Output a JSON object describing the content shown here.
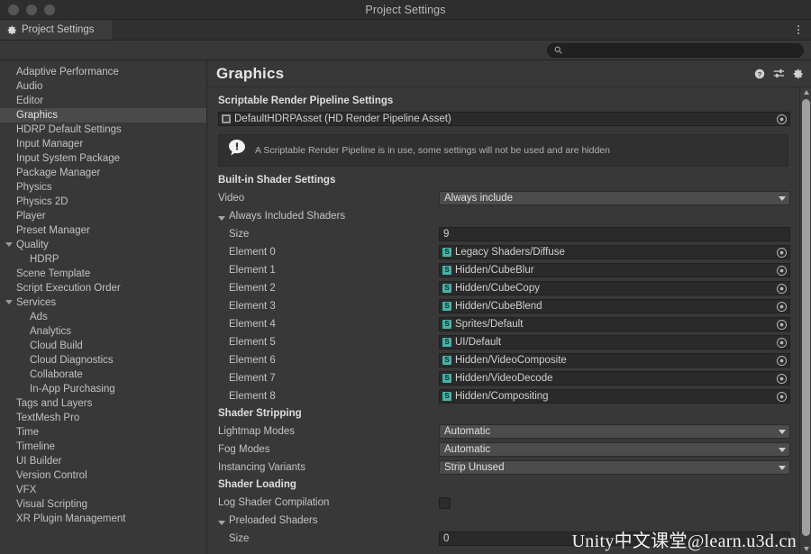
{
  "window": {
    "title": "Project Settings",
    "traffic_lights": [
      "close",
      "minimize",
      "zoom"
    ]
  },
  "tab": {
    "label": "Project Settings",
    "icon": "gear-icon",
    "menu_icon": "kebab-menu-icon"
  },
  "search": {
    "value": "",
    "placeholder": "",
    "icon": "search-icon"
  },
  "sidebar": {
    "items": [
      {
        "label": "Adaptive Performance",
        "indent": 0,
        "foldout": false,
        "selected": false
      },
      {
        "label": "Audio",
        "indent": 0,
        "foldout": false,
        "selected": false
      },
      {
        "label": "Editor",
        "indent": 0,
        "foldout": false,
        "selected": false
      },
      {
        "label": "Graphics",
        "indent": 0,
        "foldout": false,
        "selected": true
      },
      {
        "label": "HDRP Default Settings",
        "indent": 0,
        "foldout": false,
        "selected": false
      },
      {
        "label": "Input Manager",
        "indent": 0,
        "foldout": false,
        "selected": false
      },
      {
        "label": "Input System Package",
        "indent": 0,
        "foldout": false,
        "selected": false
      },
      {
        "label": "Package Manager",
        "indent": 0,
        "foldout": false,
        "selected": false
      },
      {
        "label": "Physics",
        "indent": 0,
        "foldout": false,
        "selected": false
      },
      {
        "label": "Physics 2D",
        "indent": 0,
        "foldout": false,
        "selected": false
      },
      {
        "label": "Player",
        "indent": 0,
        "foldout": false,
        "selected": false
      },
      {
        "label": "Preset Manager",
        "indent": 0,
        "foldout": false,
        "selected": false
      },
      {
        "label": "Quality",
        "indent": 0,
        "foldout": true,
        "selected": false
      },
      {
        "label": "HDRP",
        "indent": 1,
        "foldout": false,
        "selected": false
      },
      {
        "label": "Scene Template",
        "indent": 0,
        "foldout": false,
        "selected": false
      },
      {
        "label": "Script Execution Order",
        "indent": 0,
        "foldout": false,
        "selected": false
      },
      {
        "label": "Services",
        "indent": 0,
        "foldout": true,
        "selected": false
      },
      {
        "label": "Ads",
        "indent": 1,
        "foldout": false,
        "selected": false
      },
      {
        "label": "Analytics",
        "indent": 1,
        "foldout": false,
        "selected": false
      },
      {
        "label": "Cloud Build",
        "indent": 1,
        "foldout": false,
        "selected": false
      },
      {
        "label": "Cloud Diagnostics",
        "indent": 1,
        "foldout": false,
        "selected": false
      },
      {
        "label": "Collaborate",
        "indent": 1,
        "foldout": false,
        "selected": false
      },
      {
        "label": "In-App Purchasing",
        "indent": 1,
        "foldout": false,
        "selected": false
      },
      {
        "label": "Tags and Layers",
        "indent": 0,
        "foldout": false,
        "selected": false
      },
      {
        "label": "TextMesh Pro",
        "indent": 0,
        "foldout": false,
        "selected": false
      },
      {
        "label": "Time",
        "indent": 0,
        "foldout": false,
        "selected": false
      },
      {
        "label": "Timeline",
        "indent": 0,
        "foldout": false,
        "selected": false
      },
      {
        "label": "UI Builder",
        "indent": 0,
        "foldout": false,
        "selected": false
      },
      {
        "label": "Version Control",
        "indent": 0,
        "foldout": false,
        "selected": false
      },
      {
        "label": "VFX",
        "indent": 0,
        "foldout": false,
        "selected": false
      },
      {
        "label": "Visual Scripting",
        "indent": 0,
        "foldout": false,
        "selected": false
      },
      {
        "label": "XR Plugin Management",
        "indent": 0,
        "foldout": false,
        "selected": false
      }
    ]
  },
  "page": {
    "title": "Graphics",
    "header_icons": [
      "help-icon",
      "preset-sliders-icon",
      "gear-icon"
    ],
    "srp": {
      "section_title": "Scriptable Render Pipeline Settings",
      "asset_value": "DefaultHDRPAsset (HD Render Pipeline Asset)",
      "asset_icon": "asset-icon",
      "picker_icon": "object-picker-icon"
    },
    "info": {
      "icon": "info-bubble-icon",
      "message": "A Scriptable Render Pipeline is in use, some settings will not be used and are hidden"
    },
    "builtin": {
      "section_title": "Built-in Shader Settings",
      "video_label": "Video",
      "video_value": "Always include",
      "always_included_label": "Always Included Shaders",
      "size_label": "Size",
      "size_value": "9",
      "elements": [
        {
          "label": "Element 0",
          "value": "Legacy Shaders/Diffuse"
        },
        {
          "label": "Element 1",
          "value": "Hidden/CubeBlur"
        },
        {
          "label": "Element 2",
          "value": "Hidden/CubeCopy"
        },
        {
          "label": "Element 3",
          "value": "Hidden/CubeBlend"
        },
        {
          "label": "Element 4",
          "value": "Sprites/Default"
        },
        {
          "label": "Element 5",
          "value": "UI/Default"
        },
        {
          "label": "Element 6",
          "value": "Hidden/VideoComposite"
        },
        {
          "label": "Element 7",
          "value": "Hidden/VideoDecode"
        },
        {
          "label": "Element 8",
          "value": "Hidden/Compositing"
        }
      ]
    },
    "stripping": {
      "section_title": "Shader Stripping",
      "rows": [
        {
          "label": "Lightmap Modes",
          "value": "Automatic"
        },
        {
          "label": "Fog Modes",
          "value": "Automatic"
        },
        {
          "label": "Instancing Variants",
          "value": "Strip Unused"
        }
      ]
    },
    "loading": {
      "section_title": "Shader Loading",
      "log_label": "Log Shader Compilation",
      "log_checked": false,
      "preloaded_label": "Preloaded Shaders",
      "size_label": "Size",
      "size_value": "0"
    }
  },
  "scrollbar": {
    "up_icon": "scroll-up-arrow-icon",
    "down_icon": "scroll-down-arrow-icon"
  },
  "watermark": {
    "text": "Unity中文课堂@learn.u3d.cn"
  },
  "colors": {
    "background": "#383838",
    "panel": "#303030",
    "field": "#2a2a2a",
    "dropdown": "#4c4c4c",
    "selection": "#4a4a4a",
    "text": "#c4c4c4",
    "shader_icon": "#46b2a8"
  }
}
